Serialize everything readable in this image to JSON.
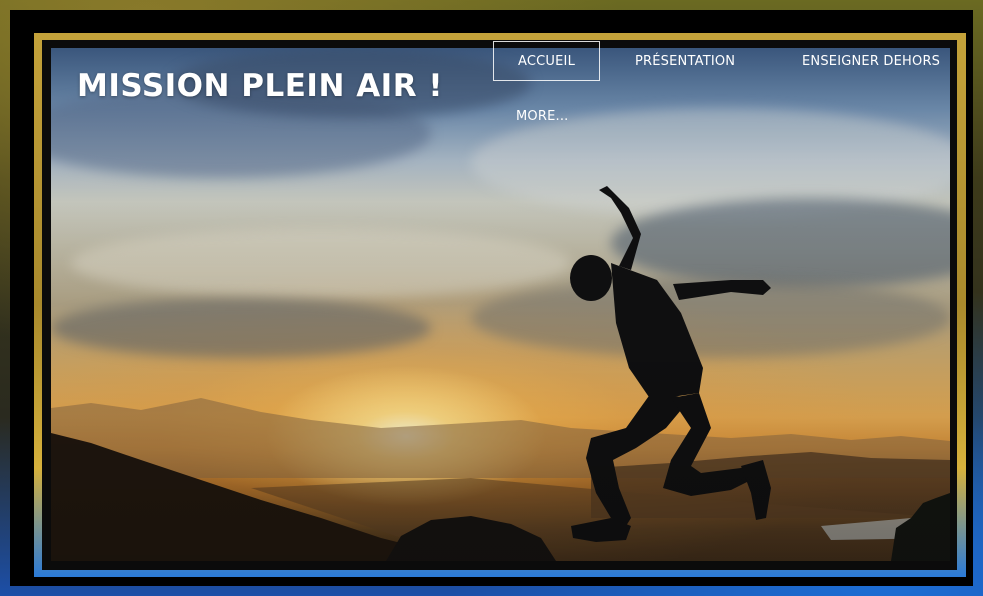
{
  "site": {
    "title": "MISSION PLEIN AIR !"
  },
  "nav": {
    "items": [
      {
        "label": "ACCUEIL",
        "active": true
      },
      {
        "label": "PRÉSENTATION",
        "active": false
      },
      {
        "label": "ENSEIGNER DEHORS",
        "active": false
      },
      {
        "label": "MORE...",
        "active": false
      }
    ]
  },
  "hero": {
    "image": "silhouette-jumping-at-sunset"
  },
  "colors": {
    "frame_outer": "#000000",
    "frame_gold": "#c4a23a",
    "accent_blue": "#2b7bd8",
    "text": "#ffffff"
  }
}
